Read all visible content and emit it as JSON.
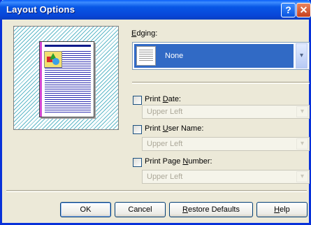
{
  "window": {
    "title": "Layout Options",
    "help_glyph": "?",
    "close_glyph": "✕"
  },
  "edging": {
    "label_first": "E",
    "label_rest": "dging:",
    "value": "None"
  },
  "print_date": {
    "label_pre": "Print ",
    "label_key": "D",
    "label_post": "ate:",
    "checked": false,
    "value": "Upper Left"
  },
  "print_user": {
    "label_pre": "Print ",
    "label_key": "U",
    "label_post": "ser Name:",
    "checked": false,
    "value": "Upper Left"
  },
  "print_page": {
    "label_pre": "Print Page ",
    "label_key": "N",
    "label_post": "umber:",
    "checked": false,
    "value": "Upper Left"
  },
  "buttons": {
    "ok": "OK",
    "cancel": "Cancel",
    "restore_key": "R",
    "restore_rest": "estore Defaults",
    "help_key": "H",
    "help_rest": "elp"
  },
  "icons": {
    "dropdown": "▾",
    "help": "help-icon",
    "close": "close-icon"
  },
  "colors": {
    "titlebar": "#0A5FF8",
    "selection": "#316AC5",
    "dialog_bg": "#ECE9D8"
  }
}
